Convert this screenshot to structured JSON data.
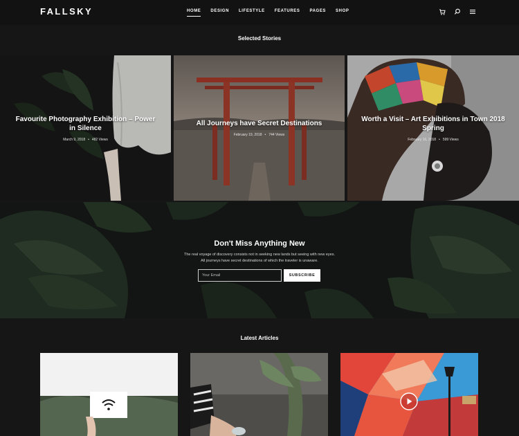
{
  "site": {
    "logo": "FALLSKY"
  },
  "nav": {
    "items": [
      "HOME",
      "DESIGN",
      "LIFESTYLE",
      "FEATURES",
      "PAGES",
      "SHOP"
    ],
    "active": "HOME"
  },
  "header_icons": [
    "cart-icon",
    "search-icon",
    "menu-icon"
  ],
  "selected": {
    "heading": "Selected Stories",
    "stories": [
      {
        "title": "Favourite Photography Exhibition – Power in Silence",
        "date": "March 9, 2018",
        "views": "482 Views"
      },
      {
        "title": "All Journeys have Secret Destinations",
        "date": "February 19, 2018",
        "views": "744 Views"
      },
      {
        "title": "Worth a Visit – Art Exhibitions in Town 2018 Spring",
        "date": "February 16, 2018",
        "views": "599 Views"
      }
    ]
  },
  "newsletter": {
    "title": "Don't Miss Anything New",
    "line1": "The real voyage of discovery consists not in seeking new lands but seeing with new eyes.",
    "line2": "All journeys have secret destinations of which the traveler is unaware.",
    "placeholder": "Your Email",
    "button": "SUBSCRIBE"
  },
  "latest": {
    "heading": "Latest Articles"
  },
  "colors": {
    "page_bg": "#161616",
    "header_bg": "#121212",
    "accent": "#ffffff"
  }
}
